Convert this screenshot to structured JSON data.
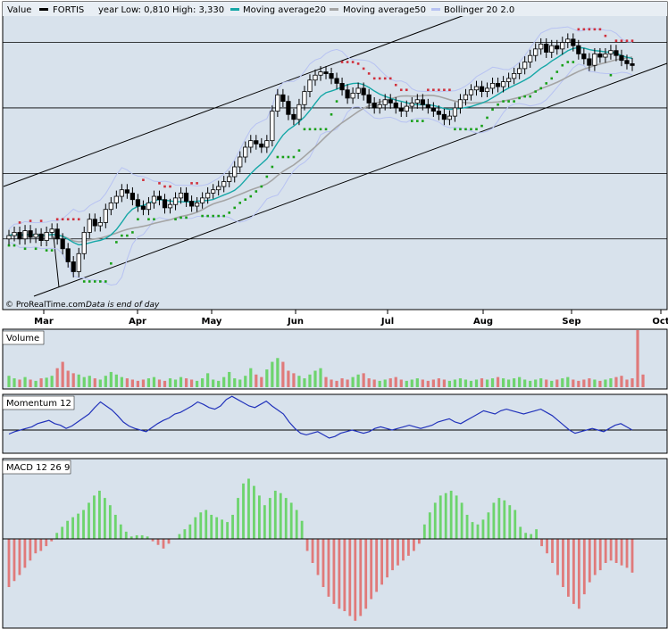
{
  "header": {
    "value_label": "Value",
    "instrument": "FORTIS",
    "range_text": "year Low: 0,810 High: 3,330",
    "ma20_label": "Moving average20",
    "ma50_label": "Moving average50",
    "boll_label": "Bollinger 20 2.0"
  },
  "footer": {
    "credit": "© ProRealTime.com",
    "note": "Data is end of day"
  },
  "colors": {
    "panel_bg": "#d8e2ec",
    "up_candle": "#ffffff",
    "down_candle": "#000000",
    "ma20": "#16a7a7",
    "ma50": "#a4a4a4",
    "bollinger": "#b7c2f2",
    "sar_up": "#18a018",
    "sar_down": "#d0303c",
    "vol_up": "#6dd46d",
    "vol_down": "#e07a7a",
    "momentum": "#2233bb",
    "macd_up": "#6dd46d",
    "macd_down": "#e07a7a"
  },
  "chart_data": [
    {
      "type": "candlestick",
      "series_names": [
        "FORTIS",
        "Moving average20",
        "Moving average50",
        "Bollinger 20 2.0"
      ],
      "x_months": [
        "Mar",
        "Apr",
        "May",
        "Jun",
        "Jul",
        "Aug",
        "Sep",
        "Oct"
      ],
      "ohlc_close": [
        2.22,
        2.24,
        2.2,
        2.25,
        2.21,
        2.23,
        2.19,
        2.24,
        2.26,
        2.2,
        2.14,
        2.06,
        2.0,
        2.11,
        2.24,
        2.32,
        2.28,
        2.3,
        2.38,
        2.42,
        2.46,
        2.5,
        2.48,
        2.44,
        2.4,
        2.38,
        2.42,
        2.46,
        2.44,
        2.39,
        2.41,
        2.45,
        2.48,
        2.43,
        2.4,
        2.42,
        2.45,
        2.48,
        2.5,
        2.52,
        2.55,
        2.58,
        2.64,
        2.7,
        2.76,
        2.8,
        2.78,
        2.76,
        2.8,
        2.98,
        3.08,
        3.04,
        2.96,
        2.93,
        3.02,
        3.1,
        3.17,
        3.2,
        3.22,
        3.21,
        3.18,
        3.15,
        3.11,
        3.06,
        3.09,
        3.12,
        3.08,
        3.03,
        3.0,
        3.02,
        3.05,
        3.03,
        3.0,
        2.98,
        3.01,
        3.03,
        3.05,
        3.02,
        3.0,
        2.98,
        2.96,
        2.93,
        2.95,
        3.0,
        3.05,
        3.08,
        3.11,
        3.13,
        3.1,
        3.12,
        3.15,
        3.13,
        3.16,
        3.18,
        3.21,
        3.24,
        3.28,
        3.32,
        3.36,
        3.39,
        3.34,
        3.38,
        3.36,
        3.4,
        3.42,
        3.38,
        3.33,
        3.3,
        3.26,
        3.33,
        3.31,
        3.33,
        3.35,
        3.32,
        3.29,
        3.27,
        3.26
      ]
    },
    {
      "type": "bar",
      "name": "Volume",
      "values": [
        18,
        14,
        12,
        16,
        12,
        10,
        14,
        15,
        18,
        30,
        40,
        26,
        22,
        20,
        16,
        18,
        14,
        12,
        18,
        24,
        20,
        16,
        14,
        12,
        10,
        12,
        14,
        16,
        12,
        10,
        14,
        12,
        16,
        14,
        12,
        10,
        14,
        22,
        12,
        10,
        16,
        24,
        14,
        12,
        18,
        30,
        20,
        16,
        28,
        40,
        46,
        40,
        26,
        22,
        18,
        14,
        20,
        26,
        30,
        16,
        12,
        10,
        14,
        12,
        16,
        20,
        22,
        14,
        12,
        10,
        12,
        14,
        16,
        12,
        10,
        12,
        14,
        12,
        10,
        12,
        14,
        12,
        10,
        12,
        14,
        12,
        10,
        12,
        14,
        12,
        14,
        16,
        14,
        12,
        14,
        16,
        12,
        10,
        12,
        14,
        12,
        10,
        12,
        14,
        16,
        12,
        10,
        12,
        14,
        12,
        10,
        12,
        14,
        16,
        18,
        12,
        14,
        90,
        20
      ]
    },
    {
      "type": "line",
      "name": "Momentum 12",
      "values": [
        -0.05,
        -0.02,
        0.0,
        0.02,
        0.04,
        0.08,
        0.1,
        0.12,
        0.08,
        0.06,
        0.02,
        0.05,
        0.1,
        0.15,
        0.2,
        0.28,
        0.35,
        0.3,
        0.25,
        0.18,
        0.1,
        0.05,
        0.02,
        0.0,
        -0.02,
        0.03,
        0.08,
        0.12,
        0.15,
        0.2,
        0.22,
        0.26,
        0.3,
        0.35,
        0.32,
        0.28,
        0.26,
        0.3,
        0.38,
        0.42,
        0.38,
        0.34,
        0.3,
        0.28,
        0.32,
        0.36,
        0.3,
        0.25,
        0.2,
        0.1,
        0.02,
        -0.04,
        -0.06,
        -0.04,
        -0.02,
        -0.06,
        -0.1,
        -0.08,
        -0.04,
        -0.02,
        0.0,
        -0.02,
        -0.04,
        -0.02,
        0.02,
        0.04,
        0.02,
        0.0,
        0.02,
        0.04,
        0.06,
        0.04,
        0.02,
        0.04,
        0.06,
        0.1,
        0.12,
        0.14,
        0.1,
        0.08,
        0.12,
        0.16,
        0.2,
        0.24,
        0.22,
        0.2,
        0.24,
        0.26,
        0.24,
        0.22,
        0.2,
        0.22,
        0.24,
        0.26,
        0.22,
        0.18,
        0.12,
        0.06,
        0.0,
        -0.04,
        -0.02,
        0.0,
        0.02,
        0.0,
        -0.02,
        0.02,
        0.06,
        0.08,
        0.04,
        0.0
      ]
    },
    {
      "type": "bar",
      "name": "MACD 12 26 9",
      "values": [
        -0.04,
        -0.035,
        -0.03,
        -0.024,
        -0.018,
        -0.012,
        -0.01,
        -0.006,
        -0.002,
        0.005,
        0.01,
        0.015,
        0.018,
        0.021,
        0.024,
        0.03,
        0.036,
        0.04,
        0.034,
        0.028,
        0.02,
        0.012,
        0.006,
        0.002,
        0.003,
        0.003,
        0.002,
        -0.002,
        -0.005,
        -0.008,
        -0.004,
        0.0,
        0.004,
        0.008,
        0.012,
        0.018,
        0.022,
        0.024,
        0.02,
        0.018,
        0.016,
        0.014,
        0.02,
        0.034,
        0.046,
        0.05,
        0.044,
        0.036,
        0.028,
        0.034,
        0.04,
        0.038,
        0.034,
        0.03,
        0.024,
        0.015,
        -0.01,
        -0.02,
        -0.03,
        -0.04,
        -0.048,
        -0.054,
        -0.058,
        -0.06,
        -0.064,
        -0.068,
        -0.064,
        -0.058,
        -0.05,
        -0.044,
        -0.038,
        -0.032,
        -0.026,
        -0.022,
        -0.018,
        -0.014,
        -0.01,
        -0.004,
        0.012,
        0.022,
        0.03,
        0.036,
        0.038,
        0.04,
        0.036,
        0.03,
        0.02,
        0.014,
        0.012,
        0.016,
        0.022,
        0.03,
        0.034,
        0.032,
        0.028,
        0.024,
        0.01,
        0.005,
        0.004,
        0.008,
        -0.006,
        -0.012,
        -0.02,
        -0.03,
        -0.04,
        -0.048,
        -0.054,
        -0.058,
        -0.046,
        -0.036,
        -0.03,
        -0.026,
        -0.02,
        -0.018,
        -0.02,
        -0.022,
        -0.024,
        -0.028
      ]
    }
  ]
}
